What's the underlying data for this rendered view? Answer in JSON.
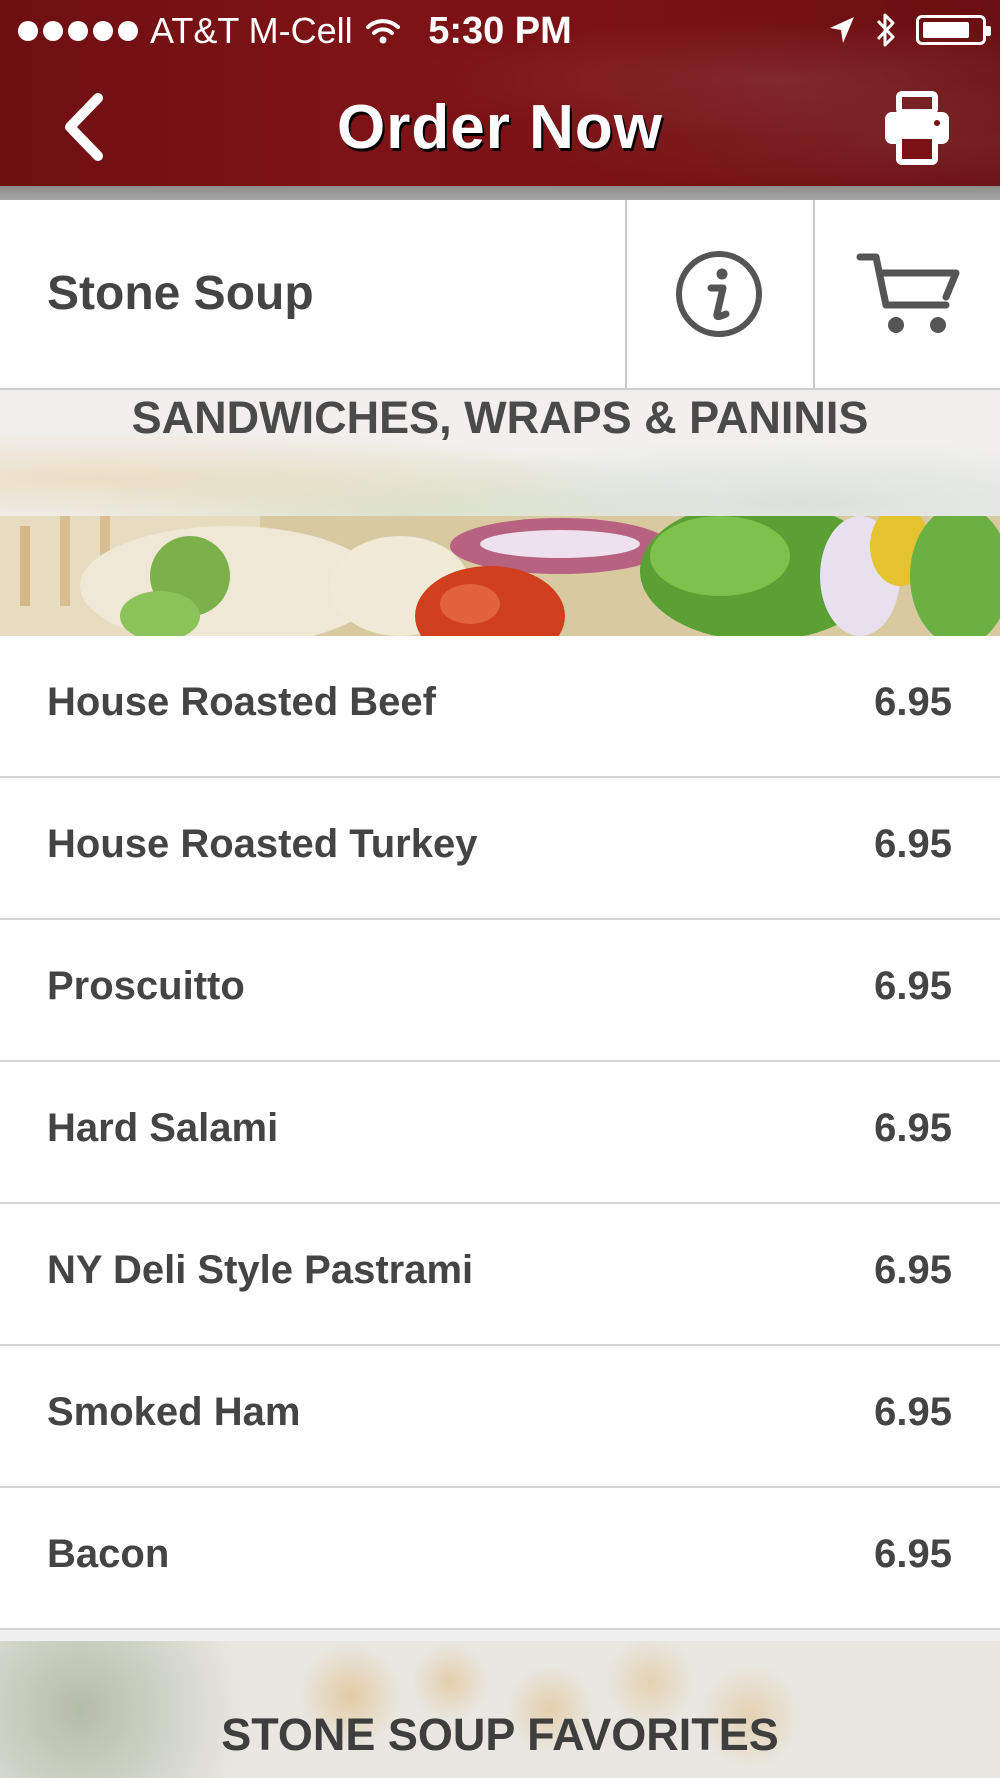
{
  "status_bar": {
    "carrier": "AT&T M-Cell",
    "time": "5:30 PM"
  },
  "nav": {
    "title": "Order Now"
  },
  "restaurant": {
    "name": "Stone Soup"
  },
  "category": {
    "title": "SANDWICHES, WRAPS & PANINIS"
  },
  "menu_items": [
    {
      "name": "House Roasted Beef",
      "price": "6.95"
    },
    {
      "name": "House Roasted Turkey",
      "price": "6.95"
    },
    {
      "name": "Proscuitto",
      "price": "6.95"
    },
    {
      "name": "Hard Salami",
      "price": "6.95"
    },
    {
      "name": "NY Deli Style Pastrami",
      "price": "6.95"
    },
    {
      "name": "Smoked Ham",
      "price": "6.95"
    },
    {
      "name": "Bacon",
      "price": "6.95"
    }
  ],
  "next_category": {
    "title": "STONE SOUP FAVORITES"
  },
  "colors": {
    "header_red": "#7a1215",
    "text_gray": "#444444",
    "divider": "#d6d6d6"
  },
  "icons": [
    "back-chevron-icon",
    "printer-icon",
    "info-icon",
    "cart-icon",
    "wifi-icon",
    "location-arrow-icon",
    "bluetooth-icon",
    "battery-icon"
  ]
}
